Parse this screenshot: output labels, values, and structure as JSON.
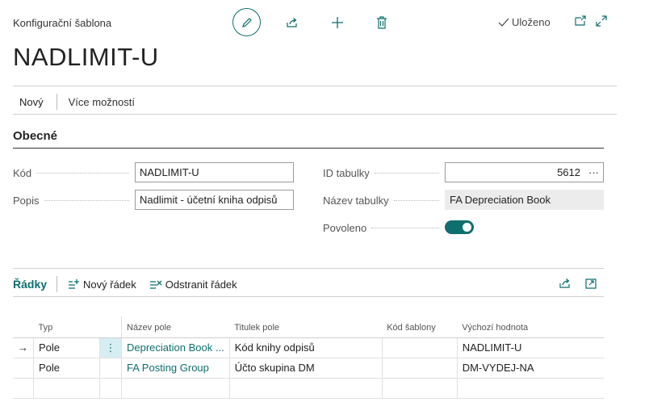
{
  "header": {
    "caption": "Konfigurační šablona",
    "saved_label": "Uloženo",
    "title": "NADLIMIT-U"
  },
  "actionbar": {
    "new_label": "Nový",
    "more_label": "Více možností"
  },
  "general": {
    "section_title": "Obecné",
    "fields": {
      "code_label": "Kód",
      "code_value": "NADLIMIT-U",
      "desc_label": "Popis",
      "desc_value": "Nadlimit - účetní kniha odpisů",
      "table_id_label": "ID tabulky",
      "table_id_value": "5612",
      "table_id_more": "···",
      "table_name_label": "Název tabulky",
      "table_name_value": "FA Depreciation Book",
      "enabled_label": "Povoleno",
      "enabled": true
    }
  },
  "lines": {
    "title": "Řádky",
    "new_line_label": "Nový řádek",
    "delete_line_label": "Odstranit řádek",
    "columns": [
      "Typ",
      "Název pole",
      "Titulek pole",
      "Kód šablony",
      "Výchozí hodnota"
    ],
    "rows": [
      {
        "indicator": "→",
        "type": "Pole",
        "menu": "⋮",
        "field_name": "Depreciation Book ...",
        "field_caption": "Kód knihy odpisů",
        "template_code": "",
        "default_value": "NADLIMIT-U"
      },
      {
        "indicator": "",
        "type": "Pole",
        "menu": "",
        "field_name": "FA Posting Group",
        "field_caption": "Účto skupina DM",
        "template_code": "",
        "default_value": "DM-VYDEJ-NA"
      }
    ]
  },
  "colors": {
    "accent": "#0f6e6e",
    "selected_cell": "#d6eef2",
    "readonly_field": "#ececec"
  }
}
